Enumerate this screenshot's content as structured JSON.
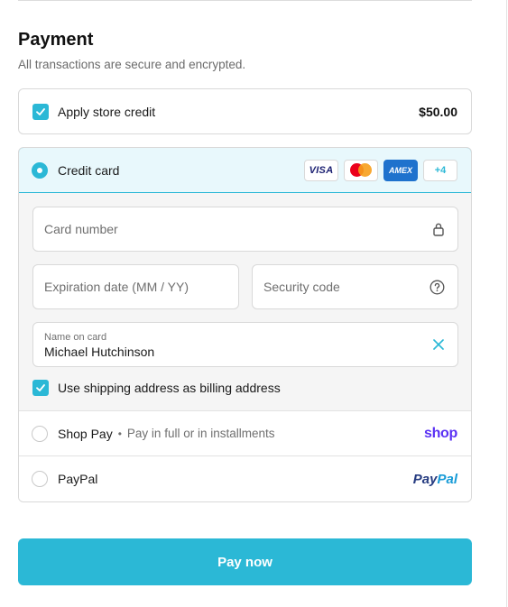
{
  "payment": {
    "title": "Payment",
    "subtitle": "All transactions are secure and encrypted."
  },
  "store_credit": {
    "label": "Apply store credit",
    "amount": "$50.00",
    "checked": true
  },
  "credit_card": {
    "label": "Credit card",
    "selected": true,
    "brands": {
      "visa": "VISA",
      "amex": "AMEX",
      "more": "+4"
    },
    "card_number_placeholder": "Card number",
    "expiration_placeholder": "Expiration date (MM / YY)",
    "security_code_placeholder": "Security code",
    "name_label": "Name on card",
    "name_value": "Michael Hutchinson",
    "billing_label": "Use shipping address as billing address",
    "billing_checked": true
  },
  "shop_pay": {
    "label": "Shop Pay",
    "separator": "•",
    "description": "Pay in full or in installments",
    "logo_text": "shop"
  },
  "paypal": {
    "label": "PayPal",
    "logo_part1": "Pay",
    "logo_part2": "Pal"
  },
  "pay_button": {
    "label": "Pay now"
  },
  "colors": {
    "accent": "#2bb8d6",
    "selected_bg": "#e8f8fc",
    "shop_purple": "#5a31f4"
  }
}
